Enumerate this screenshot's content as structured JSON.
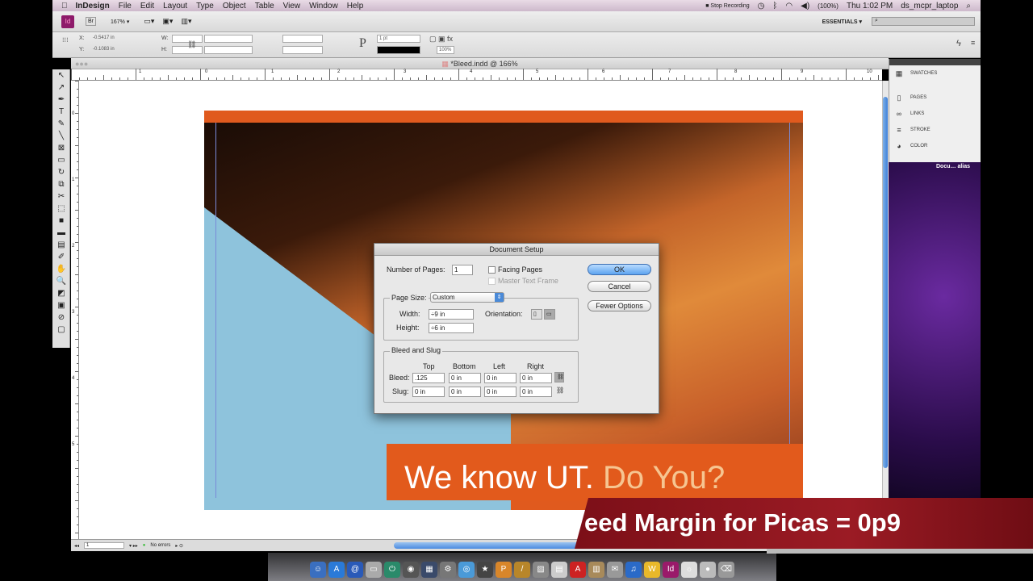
{
  "menubar": {
    "app": "InDesign",
    "items": [
      "File",
      "Edit",
      "Layout",
      "Type",
      "Object",
      "Table",
      "View",
      "Window",
      "Help"
    ],
    "recording": "Stop Recording",
    "battery": "(100%)",
    "clock": "Thu 1:02 PM",
    "user": "ds_mcpr_laptop"
  },
  "toolbar": {
    "zoom": "167% ▾",
    "workspace": "ESSENTIALS ▾",
    "br": "Br",
    "id": "Id"
  },
  "control": {
    "x_label": "X:",
    "x_value": "-0.5417 in",
    "y_label": "Y:",
    "y_value": "-0.1083 in",
    "w_label": "W:",
    "h_label": "H:",
    "stroke": "1 pt",
    "opacity": "100%"
  },
  "document": {
    "tab_title": "*Bleed.indd @ 166%",
    "headline_main": "We know UT.",
    "headline_accent": "Do You?"
  },
  "ruler": {
    "h_labels": [
      "1",
      "0",
      "1",
      "2",
      "3",
      "4",
      "5",
      "6",
      "7",
      "8",
      "9",
      "10"
    ],
    "v_labels": [
      "0",
      "1",
      "2",
      "3",
      "4",
      "5"
    ]
  },
  "tools": [
    "↖",
    "↗",
    "✒",
    "T",
    "✎",
    "╲",
    "⊠",
    "▭",
    "↻",
    "⧉",
    "✂",
    "⬚",
    "■",
    "▬",
    "▤",
    "✐",
    "✋",
    "🔍",
    "◩",
    "▣",
    "⊘",
    "▢"
  ],
  "status": {
    "page": "1",
    "errors": "No errors"
  },
  "panel": {
    "items": [
      {
        "icon": "▦",
        "label": "SWATCHES"
      },
      {
        "icon": "▯",
        "label": "PAGES"
      },
      {
        "icon": "∞",
        "label": "LINKS"
      },
      {
        "icon": "≡",
        "label": "STROKE"
      },
      {
        "icon": "◕",
        "label": "COLOR"
      }
    ],
    "desktop_alias": "Docu… alias"
  },
  "dialog": {
    "title": "Document Setup",
    "num_pages_label": "Number of Pages:",
    "num_pages": "1",
    "facing_pages": "Facing Pages",
    "master_text_frame": "Master Text Frame",
    "page_size_label": "Page Size:",
    "page_size": "Custom",
    "width_label": "Width:",
    "width": "9 in",
    "height_label": "Height:",
    "height": "6 in",
    "orientation_label": "Orientation:",
    "bleed_slug_title": "Bleed and Slug",
    "col_top": "Top",
    "col_bottom": "Bottom",
    "col_left": "Left",
    "col_right": "Right",
    "bleed_label": "Bleed:",
    "bleed": [
      ".125",
      "0 in",
      "0 in",
      "0 in"
    ],
    "slug_label": "Slug:",
    "slug": [
      "0 in",
      "0 in",
      "0 in",
      "0 in"
    ],
    "ok": "OK",
    "cancel": "Cancel",
    "fewer_options": "Fewer Options"
  },
  "overlay": {
    "caption": "eed Margin for Picas = 0p9"
  },
  "dock": [
    {
      "c": "#3a6fc0",
      "g": "☺"
    },
    {
      "c": "#2a7ad8",
      "g": "A"
    },
    {
      "c": "#2a5ab8",
      "g": "@"
    },
    {
      "c": "#aaa",
      "g": "▭"
    },
    {
      "c": "#2a8a6a",
      "g": "⏻"
    },
    {
      "c": "#555",
      "g": "◉"
    },
    {
      "c": "#3a4a6a",
      "g": "▦"
    },
    {
      "c": "#777",
      "g": "⚙"
    },
    {
      "c": "#4a9ad8",
      "g": "◎"
    },
    {
      "c": "#444",
      "g": "★"
    },
    {
      "c": "#d8862a",
      "g": "P"
    },
    {
      "c": "#b8862a",
      "g": "/"
    },
    {
      "c": "#888",
      "g": "▨"
    },
    {
      "c": "#ccc",
      "g": "▤"
    },
    {
      "c": "#c22",
      "g": "A"
    },
    {
      "c": "#a88a5a",
      "g": "▥"
    },
    {
      "c": "#999",
      "g": "✉"
    },
    {
      "c": "#2a6ac8",
      "g": "♫"
    },
    {
      "c": "#e8b82a",
      "g": "W"
    },
    {
      "c": "#9a1a6a",
      "g": "Id"
    },
    {
      "c": "#ddd",
      "g": "☼"
    },
    {
      "c": "#bbb",
      "g": "●"
    },
    {
      "c": "#999",
      "g": "⌫"
    }
  ]
}
